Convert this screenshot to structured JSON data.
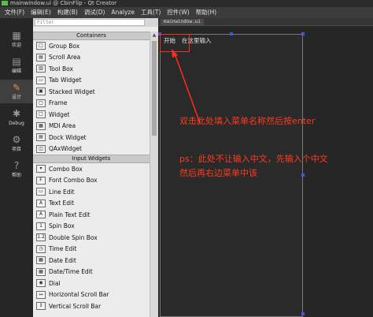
{
  "window": {
    "title": "mainwindow.ui @ CbinFlip - Qt Creator"
  },
  "menubar": [
    "文件(F)",
    "编辑(E)",
    "构建(B)",
    "调试(D)",
    "Analyze",
    "工具(T)",
    "控件(W)",
    "帮助(H)"
  ],
  "modes": [
    {
      "label": "欢迎",
      "icon": "grid-icon"
    },
    {
      "label": "编辑",
      "icon": "document-icon"
    },
    {
      "label": "设计",
      "icon": "pencil-icon",
      "active": true
    },
    {
      "label": "Debug",
      "icon": "bug-icon"
    },
    {
      "label": "项目",
      "icon": "wrench-icon"
    },
    {
      "label": "帮助",
      "icon": "help-icon"
    }
  ],
  "designer_tab": "mainwindow.ui",
  "widgetbox": {
    "filter_placeholder": "Filter",
    "categories": [
      {
        "title": "Containers",
        "items": [
          {
            "label": "Group Box",
            "glyph": "□"
          },
          {
            "label": "Scroll Area",
            "glyph": "▤"
          },
          {
            "label": "Tool Box",
            "glyph": "▥"
          },
          {
            "label": "Tab Widget",
            "glyph": "▭"
          },
          {
            "label": "Stacked Widget",
            "glyph": "▣"
          },
          {
            "label": "Frame",
            "glyph": "□"
          },
          {
            "label": "Widget",
            "glyph": "□"
          },
          {
            "label": "MDI Area",
            "glyph": "▦"
          },
          {
            "label": "Dock Widget",
            "glyph": "▤"
          },
          {
            "label": "QAxWidget",
            "glyph": "◫"
          }
        ]
      },
      {
        "title": "Input Widgets",
        "items": [
          {
            "label": "Combo Box",
            "glyph": "▾"
          },
          {
            "label": "Font Combo Box",
            "glyph": "F"
          },
          {
            "label": "Line Edit",
            "glyph": "▭"
          },
          {
            "label": "Text Edit",
            "glyph": "A"
          },
          {
            "label": "Plain Text Edit",
            "glyph": "A"
          },
          {
            "label": "Spin Box",
            "glyph": "1"
          },
          {
            "label": "Double Spin Box",
            "glyph": "1.2"
          },
          {
            "label": "Time Edit",
            "glyph": "◷"
          },
          {
            "label": "Date Edit",
            "glyph": "▦"
          },
          {
            "label": "Date/Time Edit",
            "glyph": "▦"
          },
          {
            "label": "Dial",
            "glyph": "◉"
          },
          {
            "label": "Horizontal Scroll Bar",
            "glyph": "↔"
          },
          {
            "label": "Vertical Scroll Bar",
            "glyph": "↕"
          }
        ]
      }
    ]
  },
  "form": {
    "menu_items": [
      "开始",
      "在这里输入"
    ]
  },
  "annotations": {
    "note1": "双击此处填入菜单名称然后按enter",
    "note2_line1": "ps：此处不让输入中文，先输入个中文",
    "note2_line2": "然后再右边菜单中该"
  },
  "colors": {
    "annotation": "#ff3b1f",
    "active_mode": "#f28b30",
    "handle": "#3b5bdb"
  }
}
